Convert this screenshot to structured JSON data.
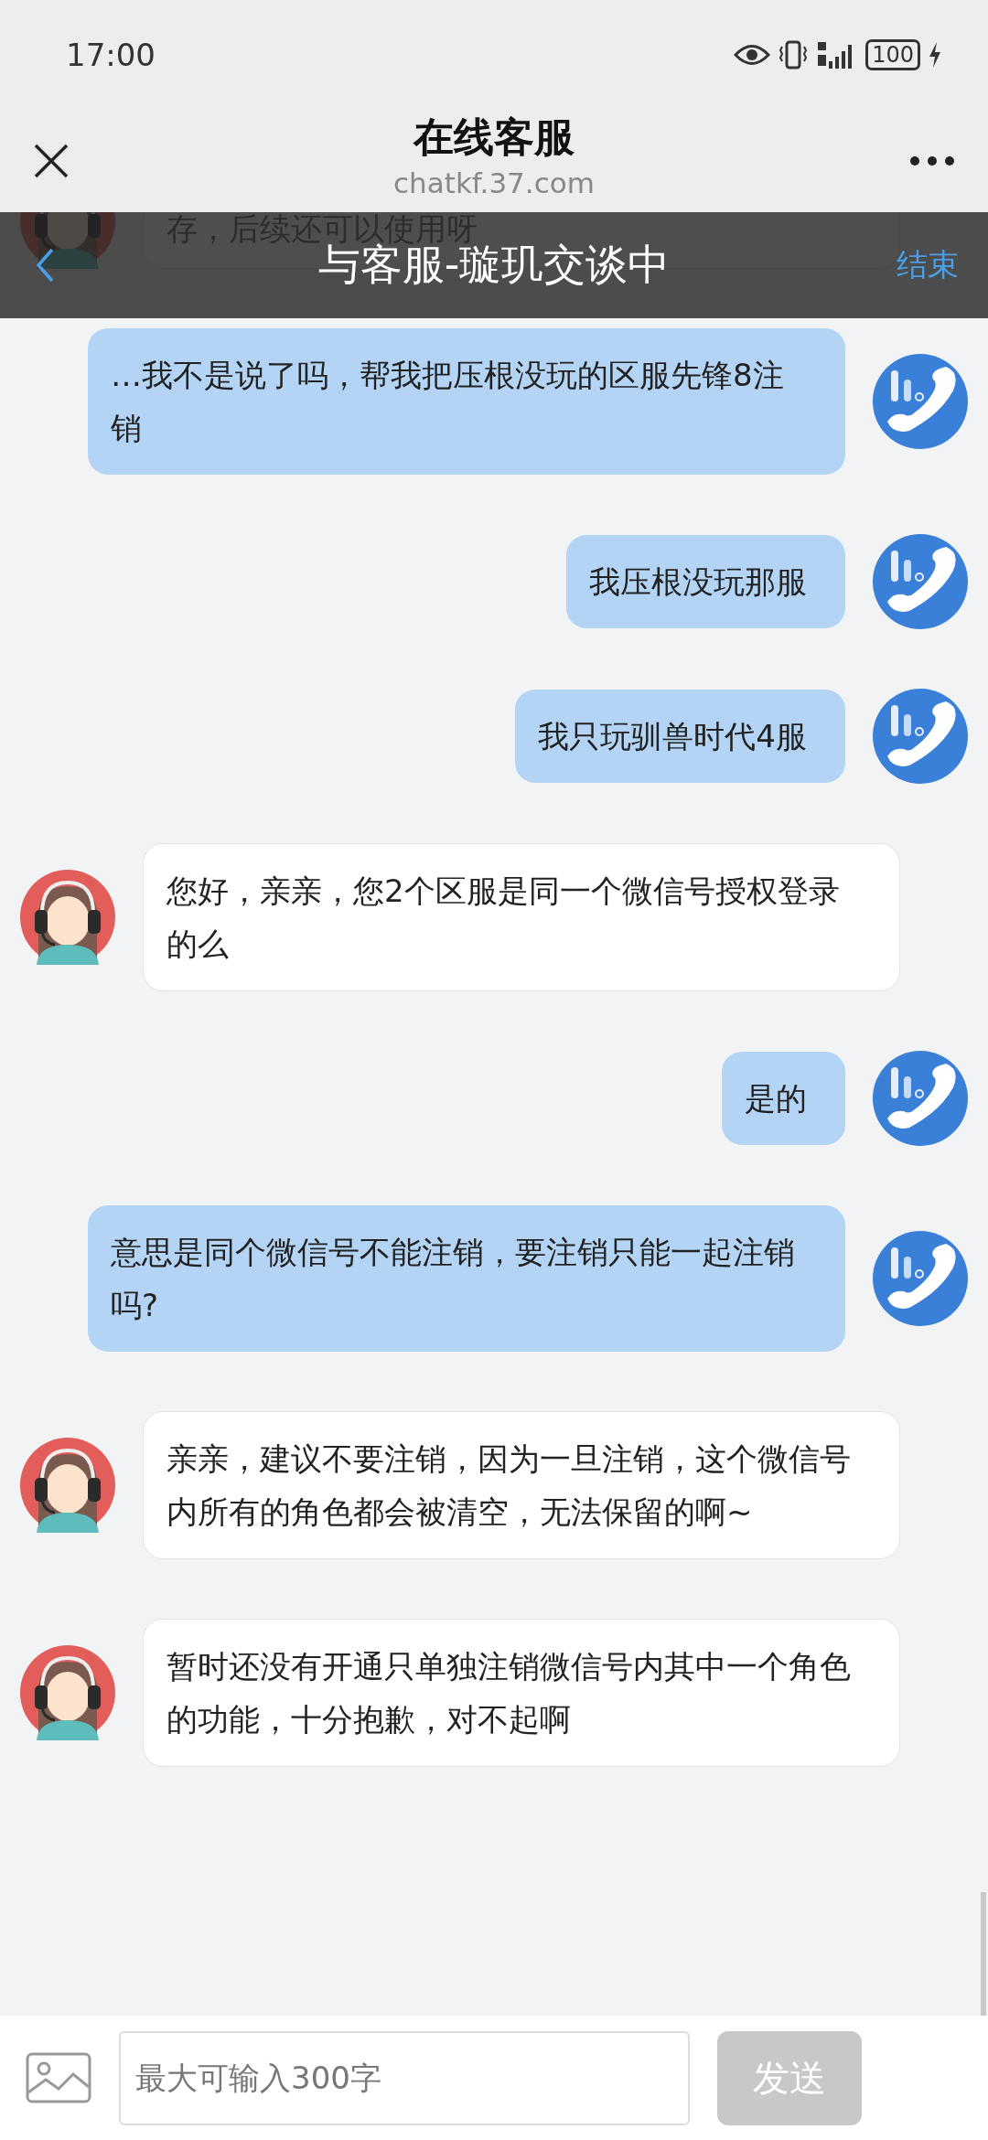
{
  "status_bar": {
    "time": "17:00",
    "battery": "100"
  },
  "header": {
    "title": "在线客服",
    "url": "chatkf.37.com"
  },
  "chat_bar": {
    "title": "与客服-璇玑交谈中",
    "end_label": "结束"
  },
  "messages": [
    {
      "kind": "agent",
      "text": "存，后续还可以使用呀",
      "partial": true
    },
    {
      "kind": "user",
      "text": "…我不是说了吗，帮我把压根没玩的区服先锋8注销"
    },
    {
      "kind": "user",
      "text": "我压根没玩那服"
    },
    {
      "kind": "user",
      "text": "我只玩驯兽时代4服"
    },
    {
      "kind": "agent",
      "text": "您好，亲亲，您2个区服是同一个微信号授权登录的么"
    },
    {
      "kind": "user",
      "text": "是的"
    },
    {
      "kind": "user",
      "text": "意思是同个微信号不能注销，要注销只能一起注销吗?"
    },
    {
      "kind": "agent",
      "text": "亲亲，建议不要注销，因为一旦注销，这个微信号内所有的角色都会被清空，无法保留的啊~"
    },
    {
      "kind": "agent",
      "text": "暂时还没有开通只单独注销微信号内其中一个角色的功能，十分抱歉，对不起啊"
    }
  ],
  "composer": {
    "placeholder": "最大可输入300字",
    "send_label": "发送",
    "send_disabled": true
  }
}
